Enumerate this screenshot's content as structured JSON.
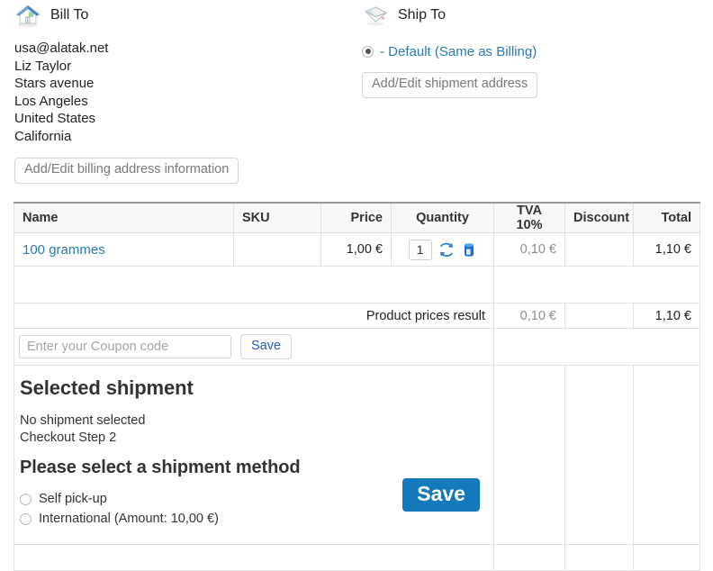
{
  "billing": {
    "icon": "house-icon",
    "title": "Bill To",
    "address_lines": [
      "usa@alatak.net",
      "Liz Taylor",
      "Stars avenue",
      "Los Angeles",
      "United States",
      "California"
    ],
    "edit_button": "Add/Edit billing address information"
  },
  "shipping": {
    "icon": "envelope-icon",
    "title": "Ship To",
    "default_option": "- Default (Same as Billing)",
    "default_selected": true,
    "edit_button": "Add/Edit shipment address"
  },
  "order_table": {
    "headers": {
      "name": "Name",
      "sku": "SKU",
      "price": "Price",
      "quantity": "Quantity",
      "tva": "TVA 10%",
      "discount": "Discount",
      "total": "Total"
    },
    "rows": [
      {
        "name": "100 grammes",
        "sku": "",
        "price": "1,00 €",
        "quantity": "1",
        "tva": "0,10 €",
        "discount": "",
        "total": "1,10 €",
        "refresh_icon": "refresh-icon",
        "delete_icon": "delete-icon"
      }
    ],
    "result_row": {
      "label": "Product prices result",
      "tva": "0,10 €",
      "discount": "",
      "total": "1,10 €"
    },
    "coupon": {
      "placeholder": "Enter your Coupon code",
      "value": "",
      "save_label": "Save"
    }
  },
  "shipment": {
    "heading": "Selected shipment",
    "status_lines": [
      "No shipment selected",
      "Checkout Step 2"
    ],
    "method_heading": "Please select a shipment method",
    "methods": [
      {
        "label": "Self pick-up",
        "selected": false
      },
      {
        "label": "International  (Amount: 10,00 €)",
        "selected": false
      }
    ],
    "save_label": "Save"
  },
  "colors": {
    "link": "#2a7ab0",
    "primary_button": "#1279ba",
    "muted_text": "#8e8e8e",
    "header_bg": "#f8f8f8",
    "border": "#e2e2e2"
  }
}
